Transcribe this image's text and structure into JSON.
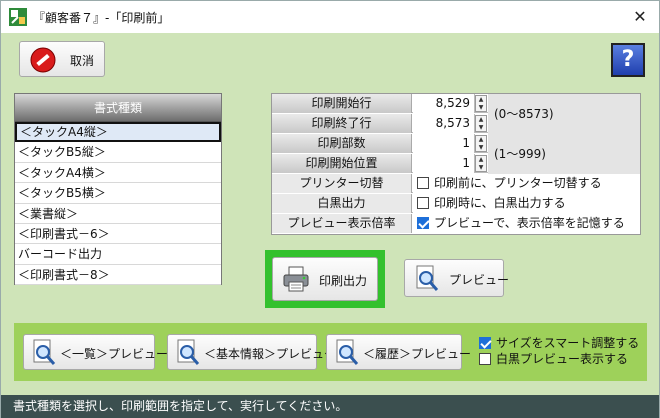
{
  "window": {
    "title": "『顧客番７』-「印刷前」"
  },
  "toolbar": {
    "cancel_label": "取消",
    "help_label": "?"
  },
  "format_list": {
    "header": "書式種類",
    "items": [
      "＜タックA4縦＞",
      "＜タックB5縦＞",
      "＜タックA4横＞",
      "＜タックB5横＞",
      "＜業書縦＞",
      "＜印刷書式－6＞",
      "バーコード出力",
      "＜印刷書式－8＞"
    ],
    "selected_index": 0
  },
  "settings": {
    "start_row_label": "印刷開始行",
    "start_row_value": "8,529",
    "end_row_label": "印刷終了行",
    "end_row_value": "8,573",
    "row_range": "(0～8573)",
    "copies_label": "印刷部数",
    "copies_value": "1",
    "start_pos_label": "印刷開始位置",
    "start_pos_value": "1",
    "copies_range": "(1～999)",
    "printer_switch_label": "プリンター切替",
    "printer_switch_text": "印刷前に、プリンター切替する",
    "printer_switch_checked": false,
    "mono_label": "白黒出力",
    "mono_text": "印刷時に、白黒出力する",
    "mono_checked": false,
    "zoom_label": "プレビュー表示倍率",
    "zoom_text": "プレビューで、表示倍率を記憶する",
    "zoom_checked": true
  },
  "actions": {
    "print_label": "印刷出力",
    "preview_label": "プレビュー"
  },
  "bottom": {
    "list_preview_label": "＜一覧＞プレビュー",
    "basic_preview_label": "＜基本情報＞プレビュー",
    "history_preview_label": "＜履歴＞プレビュー",
    "smart_size_text": "サイズをスマート調整する",
    "smart_size_checked": true,
    "mono_preview_text": "白黒プレビュー表示する",
    "mono_preview_checked": false
  },
  "status": {
    "message": "書式種類を選択し、印刷範囲を指定して、実行してください。"
  },
  "colors": {
    "panel": "#cfe4b8",
    "bottom_panel": "#9ed15a",
    "highlight": "#33c12d",
    "status": "#3b4f4f"
  }
}
